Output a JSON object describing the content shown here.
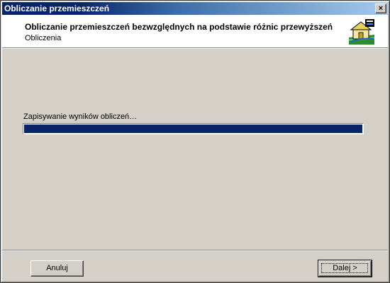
{
  "window": {
    "title": "Obliczanie przemieszczeń",
    "close_glyph": "×"
  },
  "header": {
    "title": "Obliczanie przemieszczeń bezwzględnych na podstawie różnic przewyższeń",
    "subtitle": "Obliczenia",
    "icon": "wizard-house-icon"
  },
  "main": {
    "status_text": "Zapisywanie wyników obliczeń…",
    "progress_fraction": 1.0
  },
  "footer": {
    "cancel_label": "Anuluj",
    "next_label": "Dalej >"
  },
  "colors": {
    "titlebar_active": "#0a246a",
    "progress_fill": "#0a246a",
    "face": "#d4d0c8"
  }
}
